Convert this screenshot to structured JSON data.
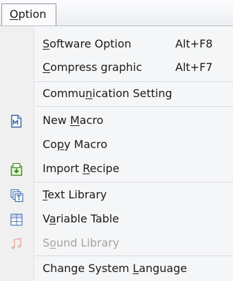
{
  "menubar": {
    "title_pre": "",
    "title_mn": "O",
    "title_post": "ption"
  },
  "items": [
    {
      "pre": "",
      "mn": "S",
      "post": "oftware Option",
      "shortcut": "Alt+F8"
    },
    {
      "pre": "",
      "mn": "C",
      "post": "ompress graphic",
      "shortcut": "Alt+F7"
    },
    {
      "pre": "Commu",
      "mn": "n",
      "post": "ication Setting"
    },
    {
      "pre": "New ",
      "mn": "M",
      "post": "acro"
    },
    {
      "pre": "Co",
      "mn": "p",
      "post": "y Macro"
    },
    {
      "pre": "Import ",
      "mn": "R",
      "post": "ecipe"
    },
    {
      "pre": "",
      "mn": "T",
      "post": "ext Library"
    },
    {
      "pre": "V",
      "mn": "a",
      "post": "riable Table"
    },
    {
      "pre": "S",
      "mn": "o",
      "post": "und Library",
      "disabled": true
    },
    {
      "pre": "Change System ",
      "mn": "L",
      "post": "anguage"
    }
  ],
  "icons": {
    "new_macro": "new-macro-icon",
    "import_recipe": "import-recipe-icon",
    "text_library": "text-library-icon",
    "variable_table": "variable-table-icon",
    "sound_library": "sound-library-icon"
  },
  "colors": {
    "disabled_text": "#a3a3a3",
    "menu_bg": "#f5f6f7",
    "gutter_bg": "#f0f0f1"
  }
}
